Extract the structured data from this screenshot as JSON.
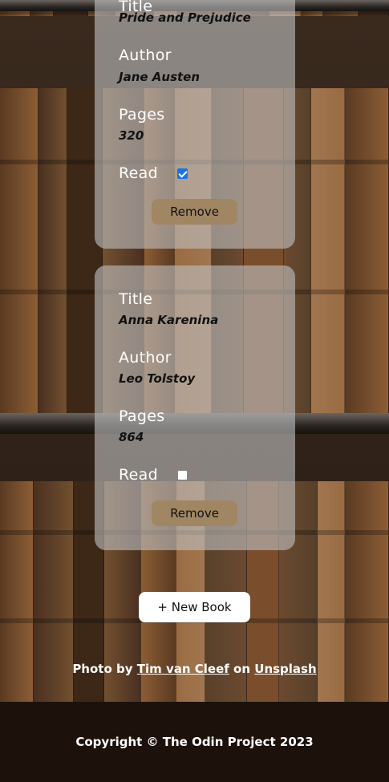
{
  "books": [
    {
      "title_label": "Title",
      "title": "Pride and Prejudice",
      "author_label": "Author",
      "author": "Jane Austen",
      "pages_label": "Pages",
      "pages": "320",
      "read_label": "Read",
      "read": true,
      "remove_label": "Remove"
    },
    {
      "title_label": "Title",
      "title": "Anna Karenina",
      "author_label": "Author",
      "author": "Leo Tolstoy",
      "pages_label": "Pages",
      "pages": "864",
      "read_label": "Read",
      "read": false,
      "remove_label": "Remove"
    }
  ],
  "new_book_label": "+ New Book",
  "credit": {
    "prefix": "Photo by",
    "photographer": "Tim van Cleef",
    "middle": "on",
    "site": "Unsplash"
  },
  "footer": {
    "copyright": "Copyright © The Odin Project 2023"
  },
  "colors": {
    "remove_button": "#a08663",
    "checkbox_checked": "#1a73e8",
    "footer_bg": "#1c120b"
  }
}
